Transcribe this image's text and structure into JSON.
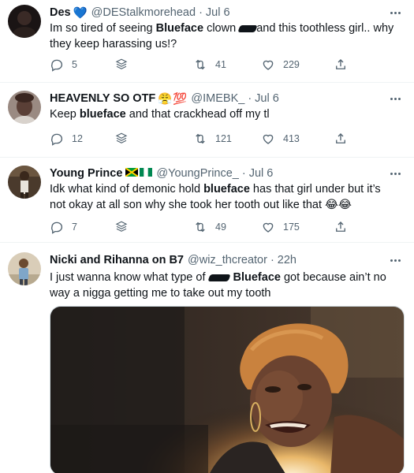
{
  "tweets": [
    {
      "name": "Des",
      "handle": "@DEStalkmorehead",
      "time": "Jul 6",
      "text_parts": [
        "Im so tired of seeing ",
        "Blueface",
        " clown ",
        "and this toothless girl.. why they keep harassing us!?"
      ],
      "replies": "5",
      "retweets": "41",
      "likes": "229"
    },
    {
      "name": "HEAVENLY SO OTF",
      "handle": "@IMEBK_",
      "time": "Jul 6",
      "text_parts": [
        "Keep ",
        "blueface",
        " and that crackhead off my tl"
      ],
      "replies": "12",
      "retweets": "121",
      "likes": "413"
    },
    {
      "name": "Young Prince",
      "handle": "@YoungPrince_",
      "time": "Jul 6",
      "text_parts": [
        "Idk what kind of demonic hold ",
        "blueface",
        " has that girl under but it’s not okay at all son why she took her tooth out like that 😂😂"
      ],
      "replies": "7",
      "retweets": "49",
      "likes": "175"
    },
    {
      "name": "Nicki and Rihanna on B7",
      "handle": "@wiz_thcreator",
      "time": "22h",
      "text_parts": [
        "I just wanna know what type of ",
        "Blueface",
        " got because ain’t no way a nigga getting me to take out my tooth"
      ]
    }
  ],
  "separator": "·",
  "emojis": {
    "des_badge": "💙",
    "heavenly_1": "😤",
    "heavenly_2": "💯",
    "young_prince_flags": "jamaica-flag nigeria-flag"
  },
  "colors": {
    "text": "#0f1419",
    "muted": "#536471",
    "divider": "#eff3f4"
  }
}
